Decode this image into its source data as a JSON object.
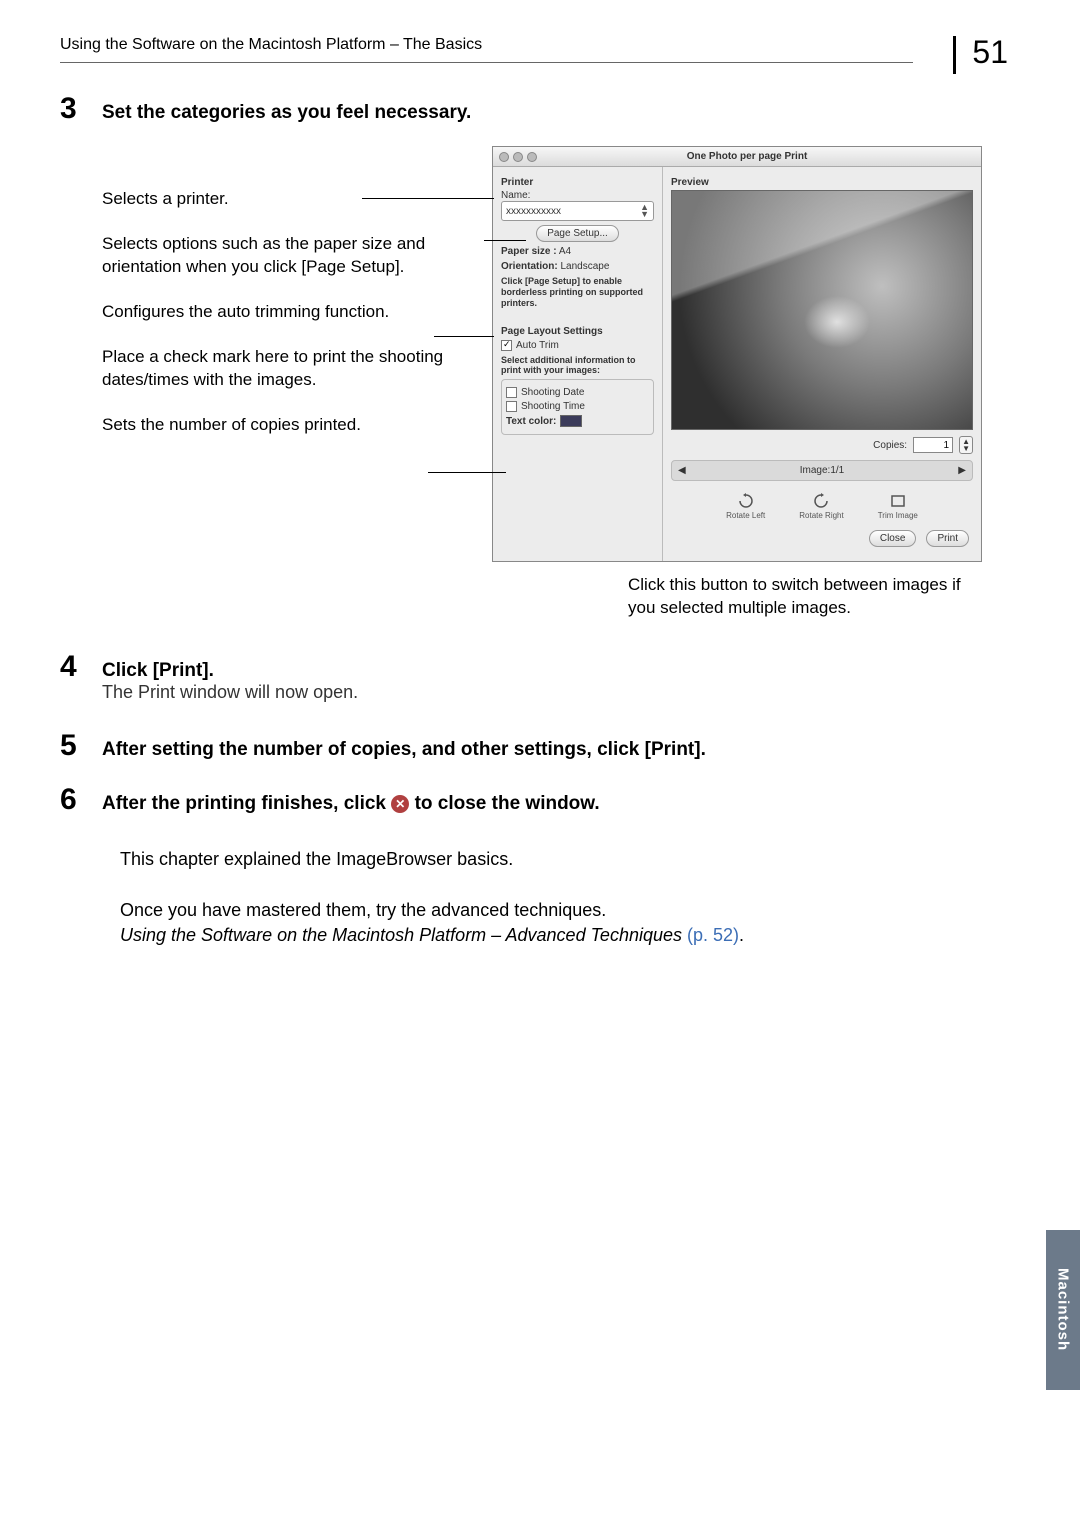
{
  "header": {
    "running_head": "Using the Software on the Macintosh Platform – The Basics",
    "page_number": "51"
  },
  "side_tab": "Macintosh",
  "steps": {
    "s3": {
      "num": "3",
      "text": "Set the categories as you feel necessary."
    },
    "s4": {
      "num": "4",
      "text": "Click [Print].",
      "sub": "The Print window will now open."
    },
    "s5": {
      "num": "5",
      "text": "After setting the number of copies, and other settings, click [Print]."
    },
    "s6": {
      "num": "6",
      "text_before": "After the printing finishes, click ",
      "text_after": " to close the window."
    }
  },
  "callouts": {
    "c1": "Selects a printer.",
    "c2": "Selects options such as the paper size and orientation when you click [Page Setup].",
    "c3": "Configures the auto trimming function.",
    "c4": "Place a check mark here to print the shooting dates/times with the images.",
    "c5": "Sets the number of copies printed.",
    "below": "Click this button to switch between images if you selected multiple images."
  },
  "dialog": {
    "title": "One Photo per page Print",
    "printer_label": "Printer",
    "name_label": "Name:",
    "printer_name": "xxxxxxxxxxx",
    "page_setup_btn": "Page Setup...",
    "paper_size_label": "Paper size :",
    "paper_size_value": "A4",
    "orientation_label": "Orientation:",
    "orientation_value": "Landscape",
    "borderless_note": "Click [Page Setup] to enable borderless printing on supported printers.",
    "layout_heading": "Page Layout Settings",
    "auto_trim": "Auto Trim",
    "additional_info": "Select additional information to print with your images:",
    "shooting_date": "Shooting Date",
    "shooting_time": "Shooting Time",
    "text_color_label": "Text color:",
    "preview_label": "Preview",
    "copies_label": "Copies:",
    "copies_value": "1",
    "image_counter": "Image:1/1",
    "rotate_left": "Rotate Left",
    "rotate_right": "Rotate Right",
    "trim_image": "Trim Image",
    "close_btn": "Close",
    "print_btn": "Print"
  },
  "closing": {
    "line1": "This chapter explained the ImageBrowser basics.",
    "line2": "Once you have mastered them, try the advanced techniques.",
    "line3_italic": "Using the Software on the Macintosh Platform – Advanced Techniques",
    "line3_link": "(p. 52)"
  }
}
